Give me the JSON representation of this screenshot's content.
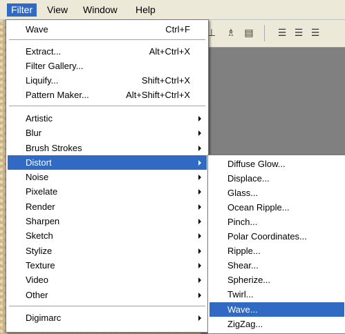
{
  "menubar": {
    "items": [
      "Filter",
      "View",
      "Window",
      "Help"
    ],
    "active": "Filter"
  },
  "toolbar_icons": [
    "align-icon",
    "distribute-icon",
    "align-center-icon",
    "align-left-icon",
    "align-middle-icon"
  ],
  "filter_menu": {
    "last_filter": {
      "label": "Wave",
      "shortcut": "Ctrl+F"
    },
    "group1": [
      {
        "label": "Extract...",
        "shortcut": "Alt+Ctrl+X"
      },
      {
        "label": "Filter Gallery...",
        "shortcut": ""
      },
      {
        "label": "Liquify...",
        "shortcut": "Shift+Ctrl+X"
      },
      {
        "label": "Pattern Maker...",
        "shortcut": "Alt+Shift+Ctrl+X"
      }
    ],
    "categories": [
      "Artistic",
      "Blur",
      "Brush Strokes",
      "Distort",
      "Noise",
      "Pixelate",
      "Render",
      "Sharpen",
      "Sketch",
      "Stylize",
      "Texture",
      "Video",
      "Other"
    ],
    "highlighted_category": "Distort",
    "extra": "Digimarc"
  },
  "distort_submenu": {
    "items": [
      "Diffuse Glow...",
      "Displace...",
      "Glass...",
      "Ocean Ripple...",
      "Pinch...",
      "Polar Coordinates...",
      "Ripple...",
      "Shear...",
      "Spherize...",
      "Twirl...",
      "Wave...",
      "ZigZag..."
    ],
    "highlighted": "Wave..."
  },
  "colors": {
    "highlight": "#316ac5",
    "menu_bg": "#ffffff",
    "menubar_bg": "#ece9d8"
  }
}
